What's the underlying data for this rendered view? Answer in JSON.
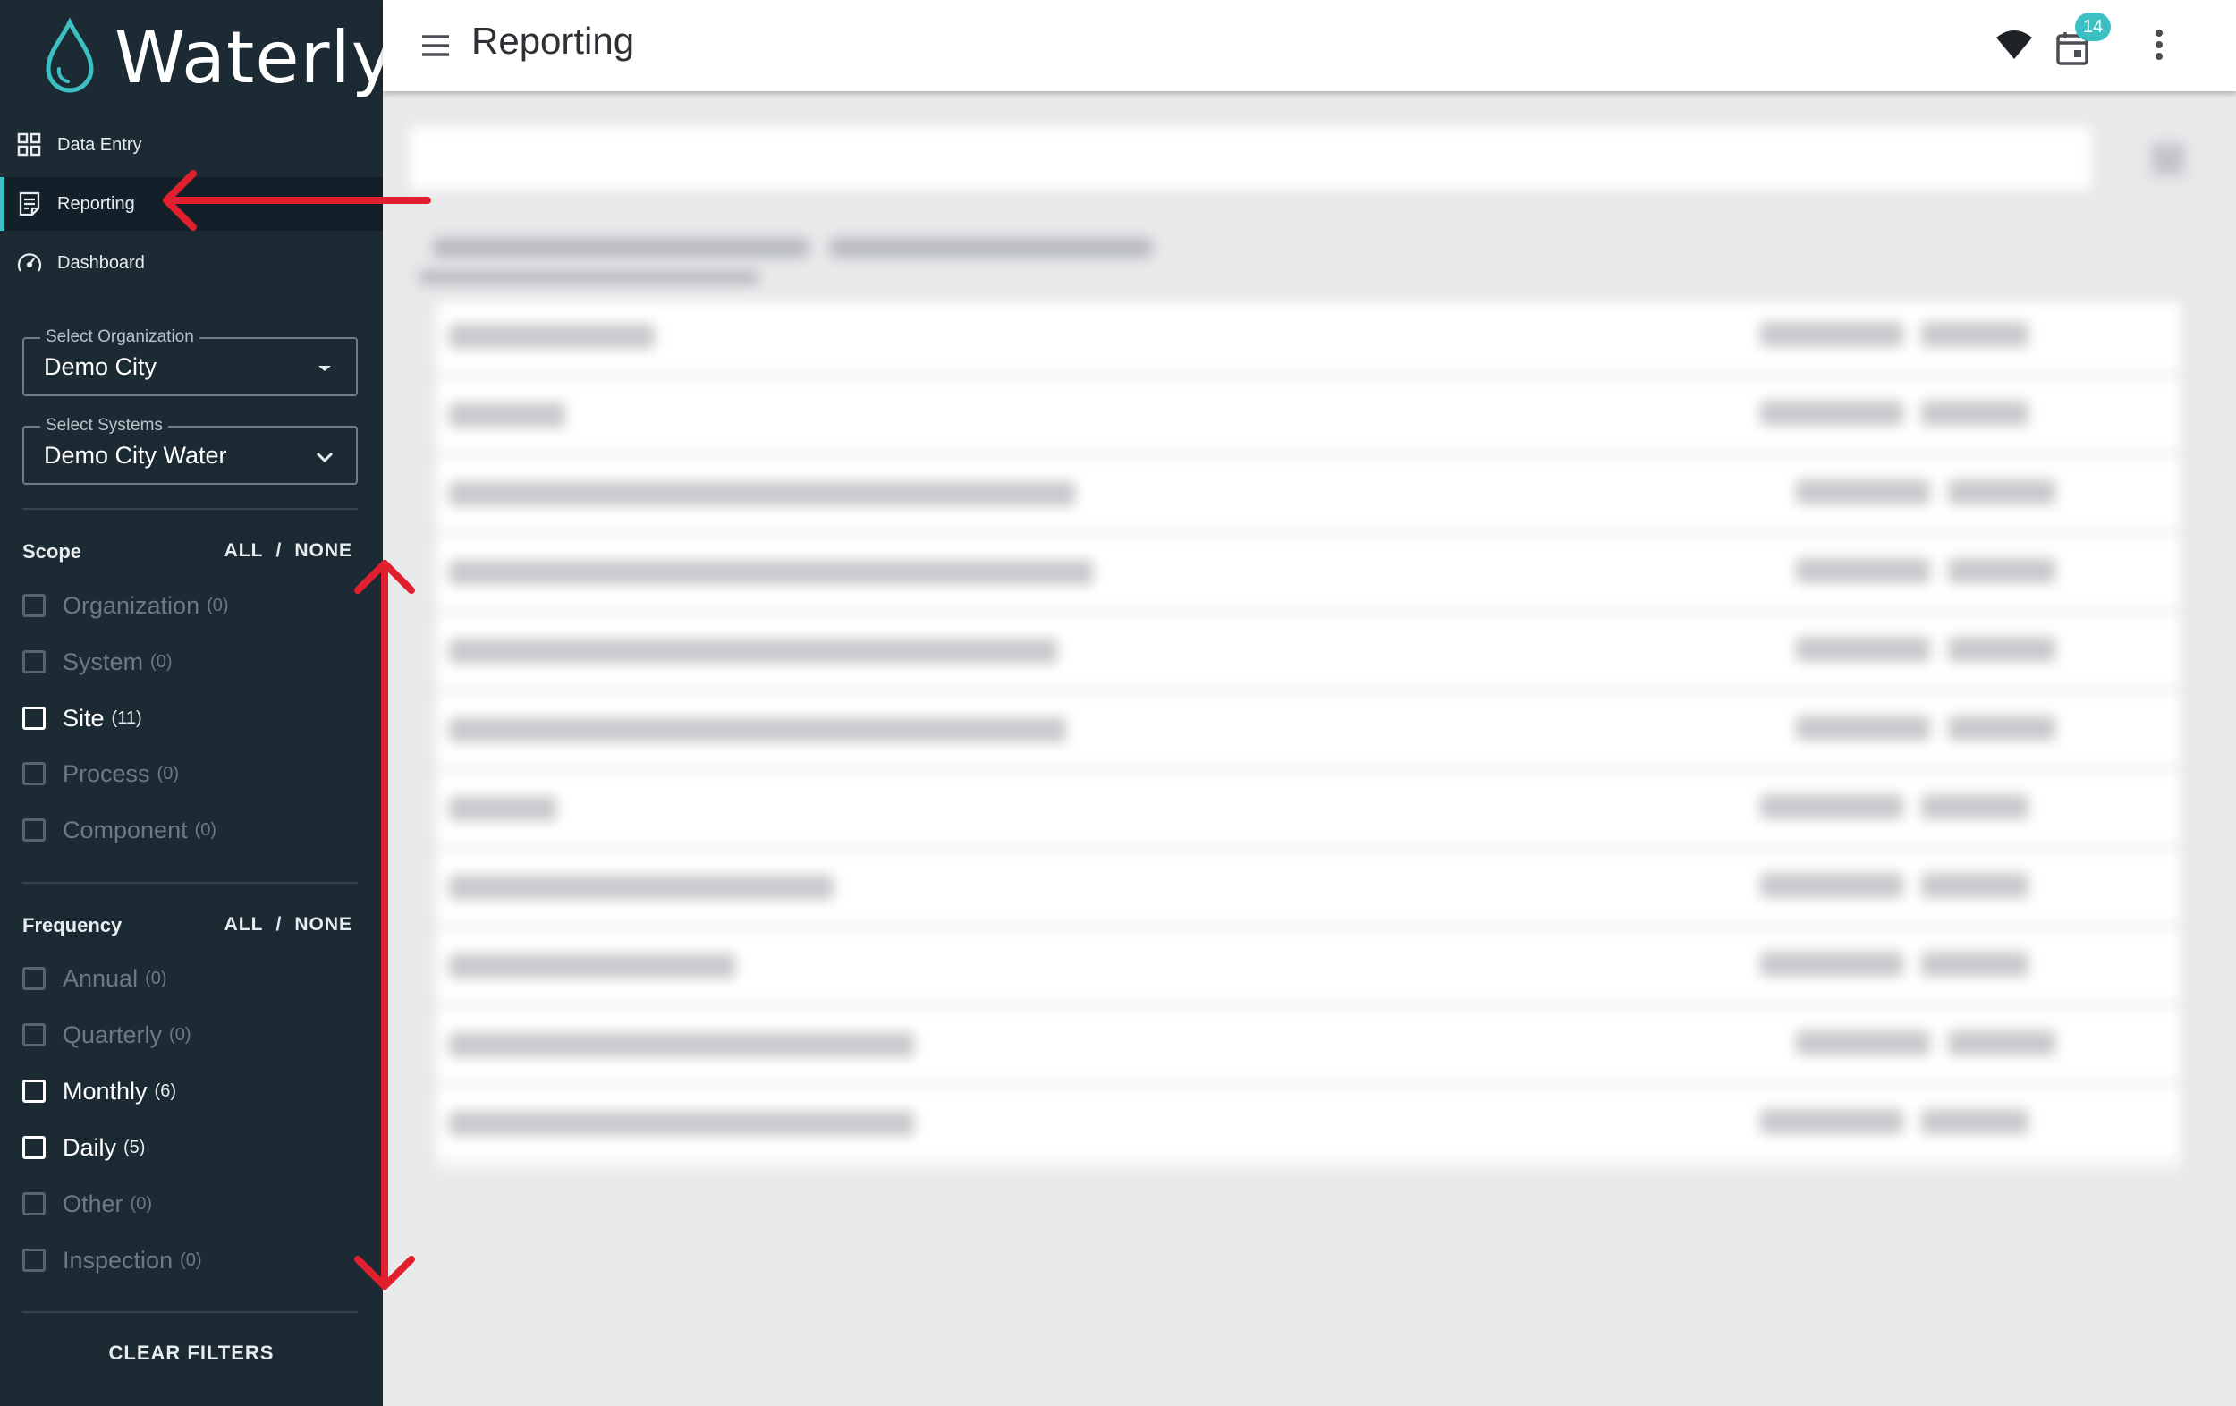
{
  "app": {
    "name": "Waterly"
  },
  "colors": {
    "sidebar_bg": "#1c2a33",
    "accent": "#3cc0c3",
    "annotation": "#e0202f"
  },
  "nav": {
    "items": [
      {
        "label": "Data Entry",
        "icon": "grid-icon"
      },
      {
        "label": "Reporting",
        "icon": "report-icon",
        "active": true
      },
      {
        "label": "Dashboard",
        "icon": "gauge-icon"
      }
    ]
  },
  "filters": {
    "organization": {
      "label": "Select Organization",
      "value": "Demo City"
    },
    "systems": {
      "label": "Select Systems",
      "value": "Demo City Water"
    },
    "scope": {
      "title": "Scope",
      "all": "ALL",
      "separator": "/",
      "none": "NONE",
      "items": [
        {
          "label": "Organization",
          "count": "(0)",
          "enabled": false
        },
        {
          "label": "System",
          "count": "(0)",
          "enabled": false
        },
        {
          "label": "Site",
          "count": "(11)",
          "enabled": true
        },
        {
          "label": "Process",
          "count": "(0)",
          "enabled": false
        },
        {
          "label": "Component",
          "count": "(0)",
          "enabled": false
        }
      ]
    },
    "frequency": {
      "title": "Frequency",
      "all": "ALL",
      "separator": "/",
      "none": "NONE",
      "items": [
        {
          "label": "Annual",
          "count": "(0)",
          "enabled": false
        },
        {
          "label": "Quarterly",
          "count": "(0)",
          "enabled": false
        },
        {
          "label": "Monthly",
          "count": "(6)",
          "enabled": true
        },
        {
          "label": "Daily",
          "count": "(5)",
          "enabled": true
        },
        {
          "label": "Other",
          "count": "(0)",
          "enabled": false
        },
        {
          "label": "Inspection",
          "count": "(0)",
          "enabled": false
        }
      ]
    },
    "clear_label": "CLEAR FILTERS"
  },
  "header": {
    "title": "Reporting",
    "notification_count": "14"
  }
}
